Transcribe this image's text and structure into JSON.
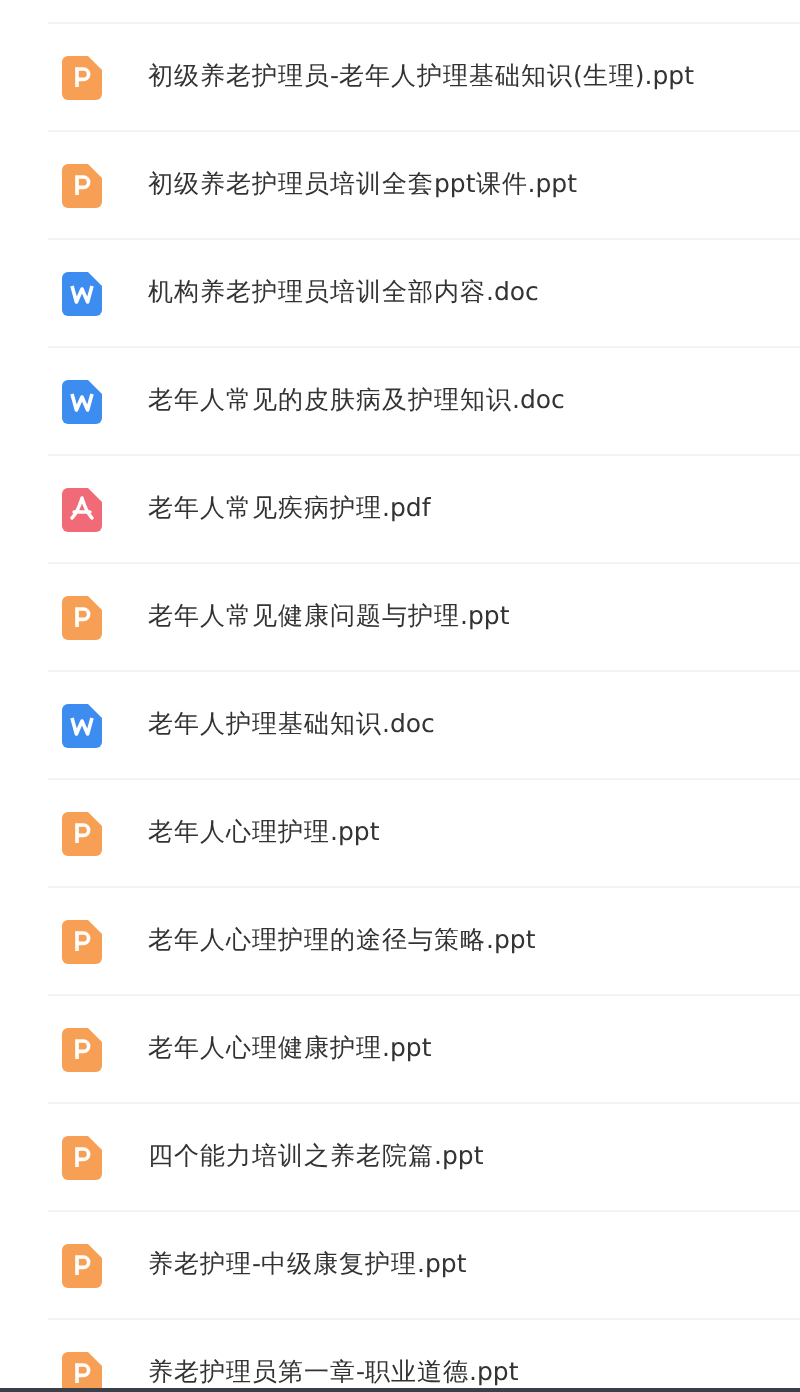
{
  "files": [
    {
      "kind": "ppt",
      "name": "初级养老护理员-老年人护理基础知识(生理).ppt"
    },
    {
      "kind": "ppt",
      "name": "初级养老护理员培训全套ppt课件.ppt"
    },
    {
      "kind": "doc",
      "name": "机构养老护理员培训全部内容.doc"
    },
    {
      "kind": "doc",
      "name": "老年人常见的皮肤病及护理知识.doc"
    },
    {
      "kind": "pdf",
      "name": "老年人常见疾病护理.pdf"
    },
    {
      "kind": "ppt",
      "name": "老年人常见健康问题与护理.ppt"
    },
    {
      "kind": "doc",
      "name": "老年人护理基础知识.doc"
    },
    {
      "kind": "ppt",
      "name": "老年人心理护理.ppt"
    },
    {
      "kind": "ppt",
      "name": "老年人心理护理的途径与策略.ppt"
    },
    {
      "kind": "ppt",
      "name": "老年人心理健康护理.ppt"
    },
    {
      "kind": "ppt",
      "name": "四个能力培训之养老院篇.ppt"
    },
    {
      "kind": "ppt",
      "name": "养老护理-中级康复护理.ppt"
    },
    {
      "kind": "ppt",
      "name": "养老护理员第一章-职业道德.ppt"
    }
  ]
}
